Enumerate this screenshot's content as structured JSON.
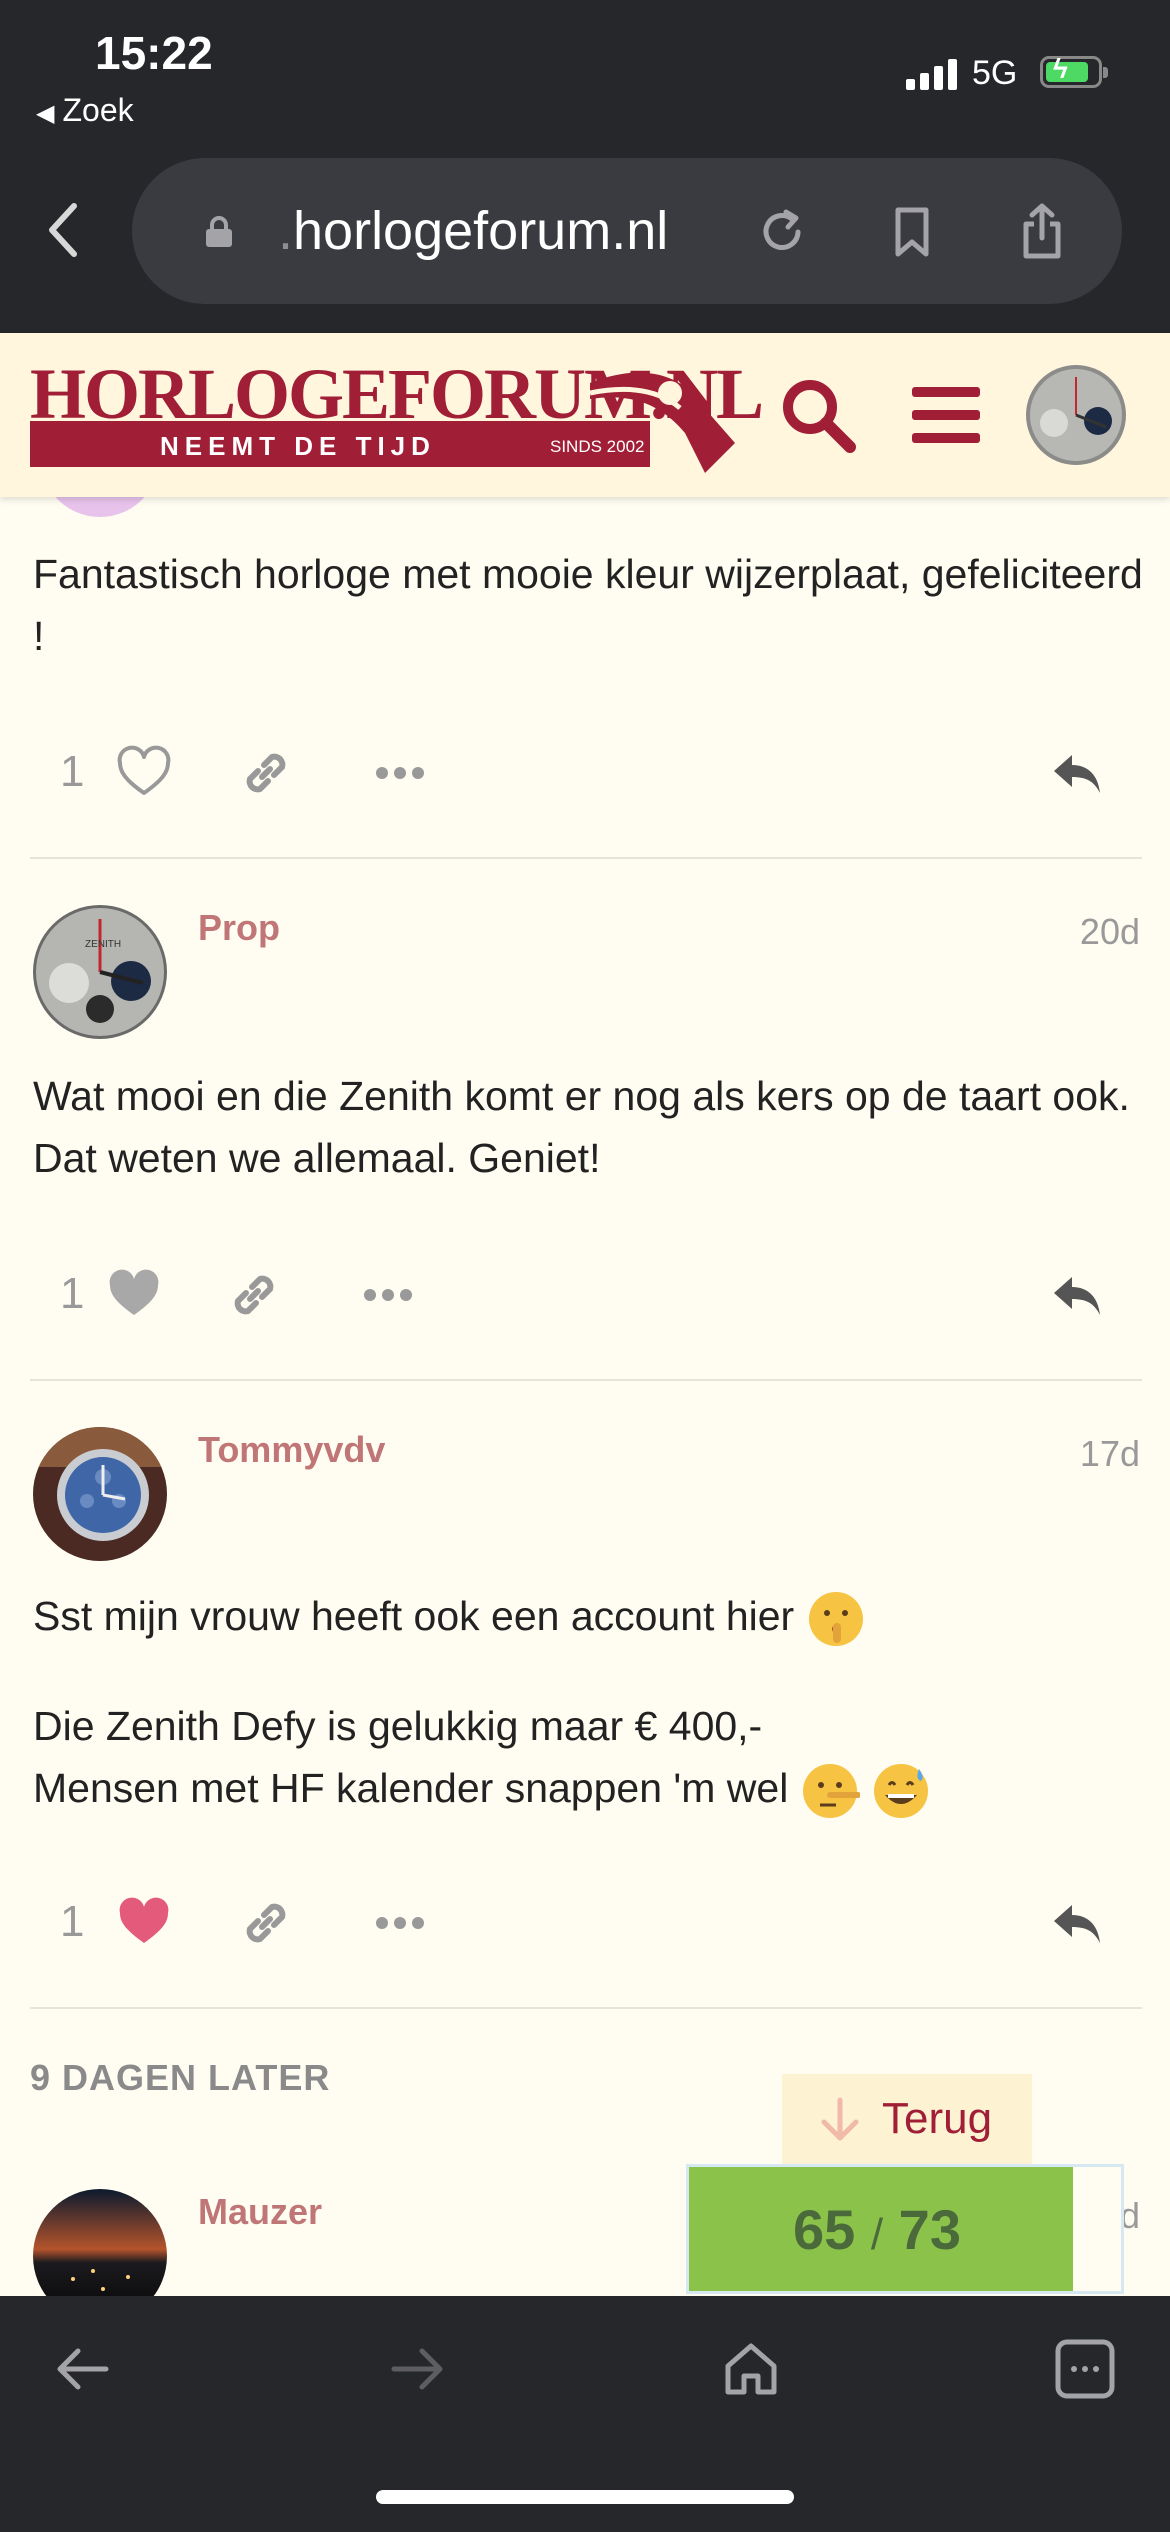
{
  "status_bar": {
    "time": "15:22",
    "back_app": "Zoek",
    "network": "5G"
  },
  "browser": {
    "url_dim": ".",
    "url_main": "horlogeforum.nl"
  },
  "forum": {
    "logo_title": "HORLOGEFORUM.NL",
    "logo_tagline": "NEEMT DE TIJD",
    "logo_since": "SINDS 2002"
  },
  "posts": [
    {
      "text": "Fantastisch horloge met mooie kleur wijzerplaat, gefeliciteerd !",
      "likes": "1",
      "liked": false
    },
    {
      "username": "Prop",
      "date": "20d",
      "text": "Wat mooi en die Zenith komt er nog als kers op de taart ook. Dat weten we allemaal. Geniet!",
      "likes": "1",
      "liked": "grey"
    },
    {
      "username": "Tommyvdv",
      "date": "17d",
      "text_line1": "Sst mijn vrouw heeft ook een account hier",
      "text_line2": "Die Zenith Defy is gelukkig maar € 400,-",
      "text_line3": "Mensen met HF kalender snappen 'm wel",
      "likes": "1",
      "liked": true
    }
  ],
  "small_action": "9 DAGEN LATER",
  "next_post": {
    "username": "Mauzer",
    "date_partial": "d"
  },
  "timeline": {
    "back_label": "Terug",
    "current": "65",
    "separator": "/",
    "total": "73",
    "progress_fraction": 0.89
  },
  "colors": {
    "brand": "#a01f36",
    "username": "#c07676",
    "like_active": "#e45a7b",
    "progress": "#8bc34a",
    "background": "#fffdf1"
  }
}
